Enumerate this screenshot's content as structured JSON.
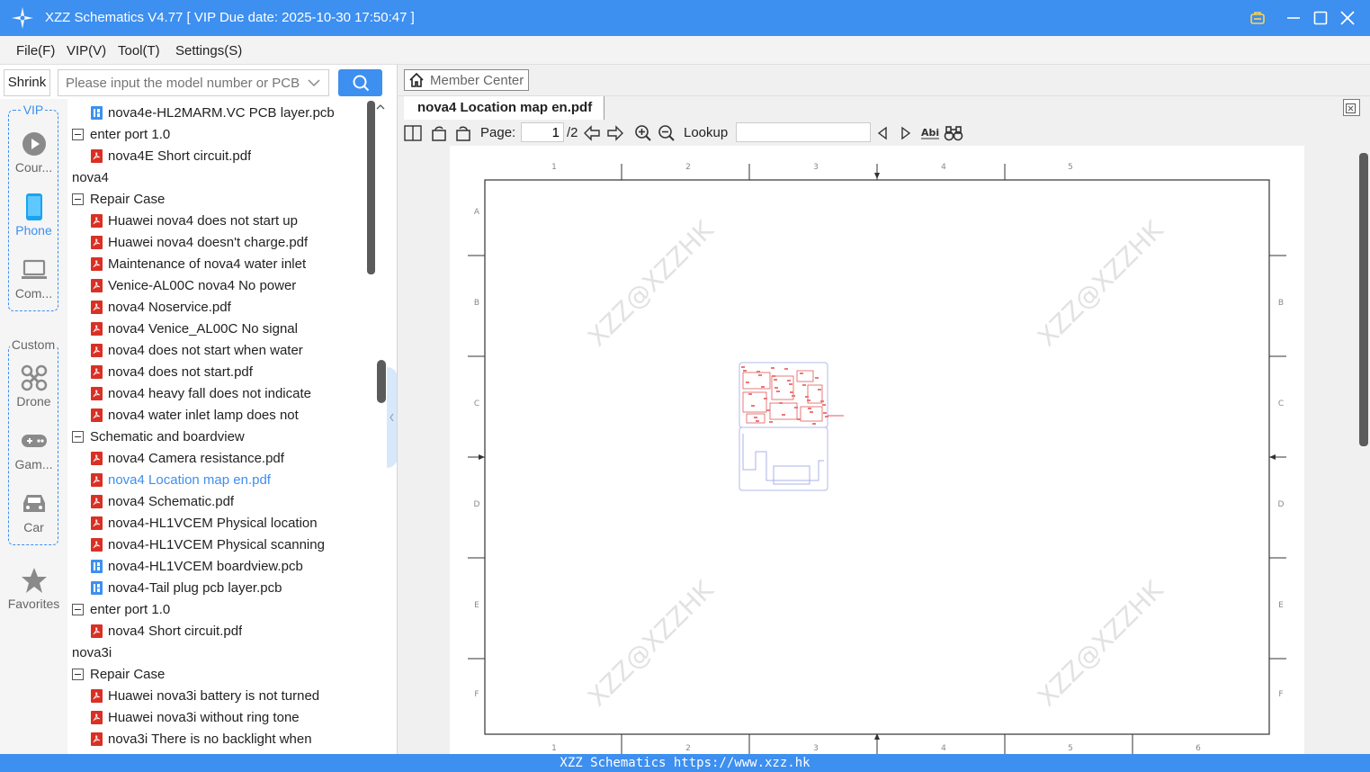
{
  "window": {
    "title": "XZZ Schematics V4.77 [ VIP Due date: 2025-10-30 17:50:47 ]"
  },
  "menu": [
    "File(F)",
    "VIP(V)",
    "Tool(T)",
    "Settings(S)"
  ],
  "search": {
    "shrink_label": "Shrink",
    "placeholder": "Please input the model number or PCB"
  },
  "rail": {
    "vip_label": "VIP",
    "custom_label": "Custom",
    "items": [
      {
        "label": "Cour...",
        "icon": "play-circle-icon"
      },
      {
        "label": "Phone",
        "icon": "phone-icon",
        "active": true
      },
      {
        "label": "Com...",
        "icon": "laptop-icon"
      },
      {
        "label": "Drone",
        "icon": "drone-icon"
      },
      {
        "label": "Gam...",
        "icon": "gamepad-icon"
      },
      {
        "label": "Car",
        "icon": "car-icon"
      },
      {
        "label": "Favorites",
        "icon": "star-icon"
      }
    ]
  },
  "tree": [
    {
      "label": "nova4e-HL2MARM.VC PCB layer.pcb",
      "level": 2,
      "kind": "pcb"
    },
    {
      "label": "enter port 1.0",
      "level": 1,
      "kind": "folder"
    },
    {
      "label": "nova4E Short circuit.pdf",
      "level": 2,
      "kind": "pdf"
    },
    {
      "label": "nova4",
      "level": 0,
      "kind": "folder"
    },
    {
      "label": "Repair Case",
      "level": 1,
      "kind": "folder"
    },
    {
      "label": "Huawei nova4 does not start up",
      "level": 2,
      "kind": "pdf"
    },
    {
      "label": "Huawei nova4 doesn't charge.pdf",
      "level": 2,
      "kind": "pdf"
    },
    {
      "label": "Maintenance of nova4 water inlet",
      "level": 2,
      "kind": "pdf"
    },
    {
      "label": "Venice-AL00C nova4 No power",
      "level": 2,
      "kind": "pdf"
    },
    {
      "label": "nova4 Noservice.pdf",
      "level": 2,
      "kind": "pdf"
    },
    {
      "label": "nova4 Venice_AL00C No signal",
      "level": 2,
      "kind": "pdf"
    },
    {
      "label": "nova4 does not start when water",
      "level": 2,
      "kind": "pdf"
    },
    {
      "label": "nova4 does not start.pdf",
      "level": 2,
      "kind": "pdf"
    },
    {
      "label": "nova4 heavy fall does not indicate",
      "level": 2,
      "kind": "pdf"
    },
    {
      "label": "nova4 water inlet lamp does not",
      "level": 2,
      "kind": "pdf"
    },
    {
      "label": "Schematic and boardview",
      "level": 1,
      "kind": "folder"
    },
    {
      "label": "nova4 Camera resistance.pdf",
      "level": 2,
      "kind": "pdf"
    },
    {
      "label": "nova4 Location map en.pdf",
      "level": 2,
      "kind": "pdf",
      "selected": true
    },
    {
      "label": "nova4 Schematic.pdf",
      "level": 2,
      "kind": "pdf"
    },
    {
      "label": "nova4-HL1VCEM Physical location",
      "level": 2,
      "kind": "pdf"
    },
    {
      "label": "nova4-HL1VCEM Physical scanning",
      "level": 2,
      "kind": "pdf"
    },
    {
      "label": "nova4-HL1VCEM boardview.pcb",
      "level": 2,
      "kind": "pcb"
    },
    {
      "label": "nova4-Tail plug pcb layer.pcb",
      "level": 2,
      "kind": "pcb"
    },
    {
      "label": "enter port 1.0",
      "level": 1,
      "kind": "folder"
    },
    {
      "label": "nova4 Short circuit.pdf",
      "level": 2,
      "kind": "pdf"
    },
    {
      "label": "nova3i",
      "level": 0,
      "kind": "folder"
    },
    {
      "label": "Repair Case",
      "level": 1,
      "kind": "folder"
    },
    {
      "label": "Huawei nova3i battery is not turned",
      "level": 2,
      "kind": "pdf"
    },
    {
      "label": "Huawei nova3i without ring tone",
      "level": 2,
      "kind": "pdf"
    },
    {
      "label": "nova3i There is no backlight when",
      "level": 2,
      "kind": "pdf"
    }
  ],
  "docpane": {
    "member_center": "Member Center",
    "tab_title": "nova4 Location map en.pdf",
    "page_label": "Page:",
    "page_current": "1",
    "page_total": "/2",
    "lookup_label": "Lookup"
  },
  "drawing": {
    "col_numbers_top": [
      "1",
      "2",
      "3",
      "4",
      "5"
    ],
    "col_numbers_bottom": [
      "1",
      "2",
      "3",
      "4",
      "5",
      "6"
    ],
    "row_letters": [
      "A",
      "B",
      "C",
      "D",
      "E",
      "F"
    ],
    "watermark": "XZZ@XZZHK"
  },
  "status": "XZZ Schematics https://www.xzz.hk",
  "colors": {
    "accent": "#3d8ff0",
    "pdf": "#d93025"
  }
}
